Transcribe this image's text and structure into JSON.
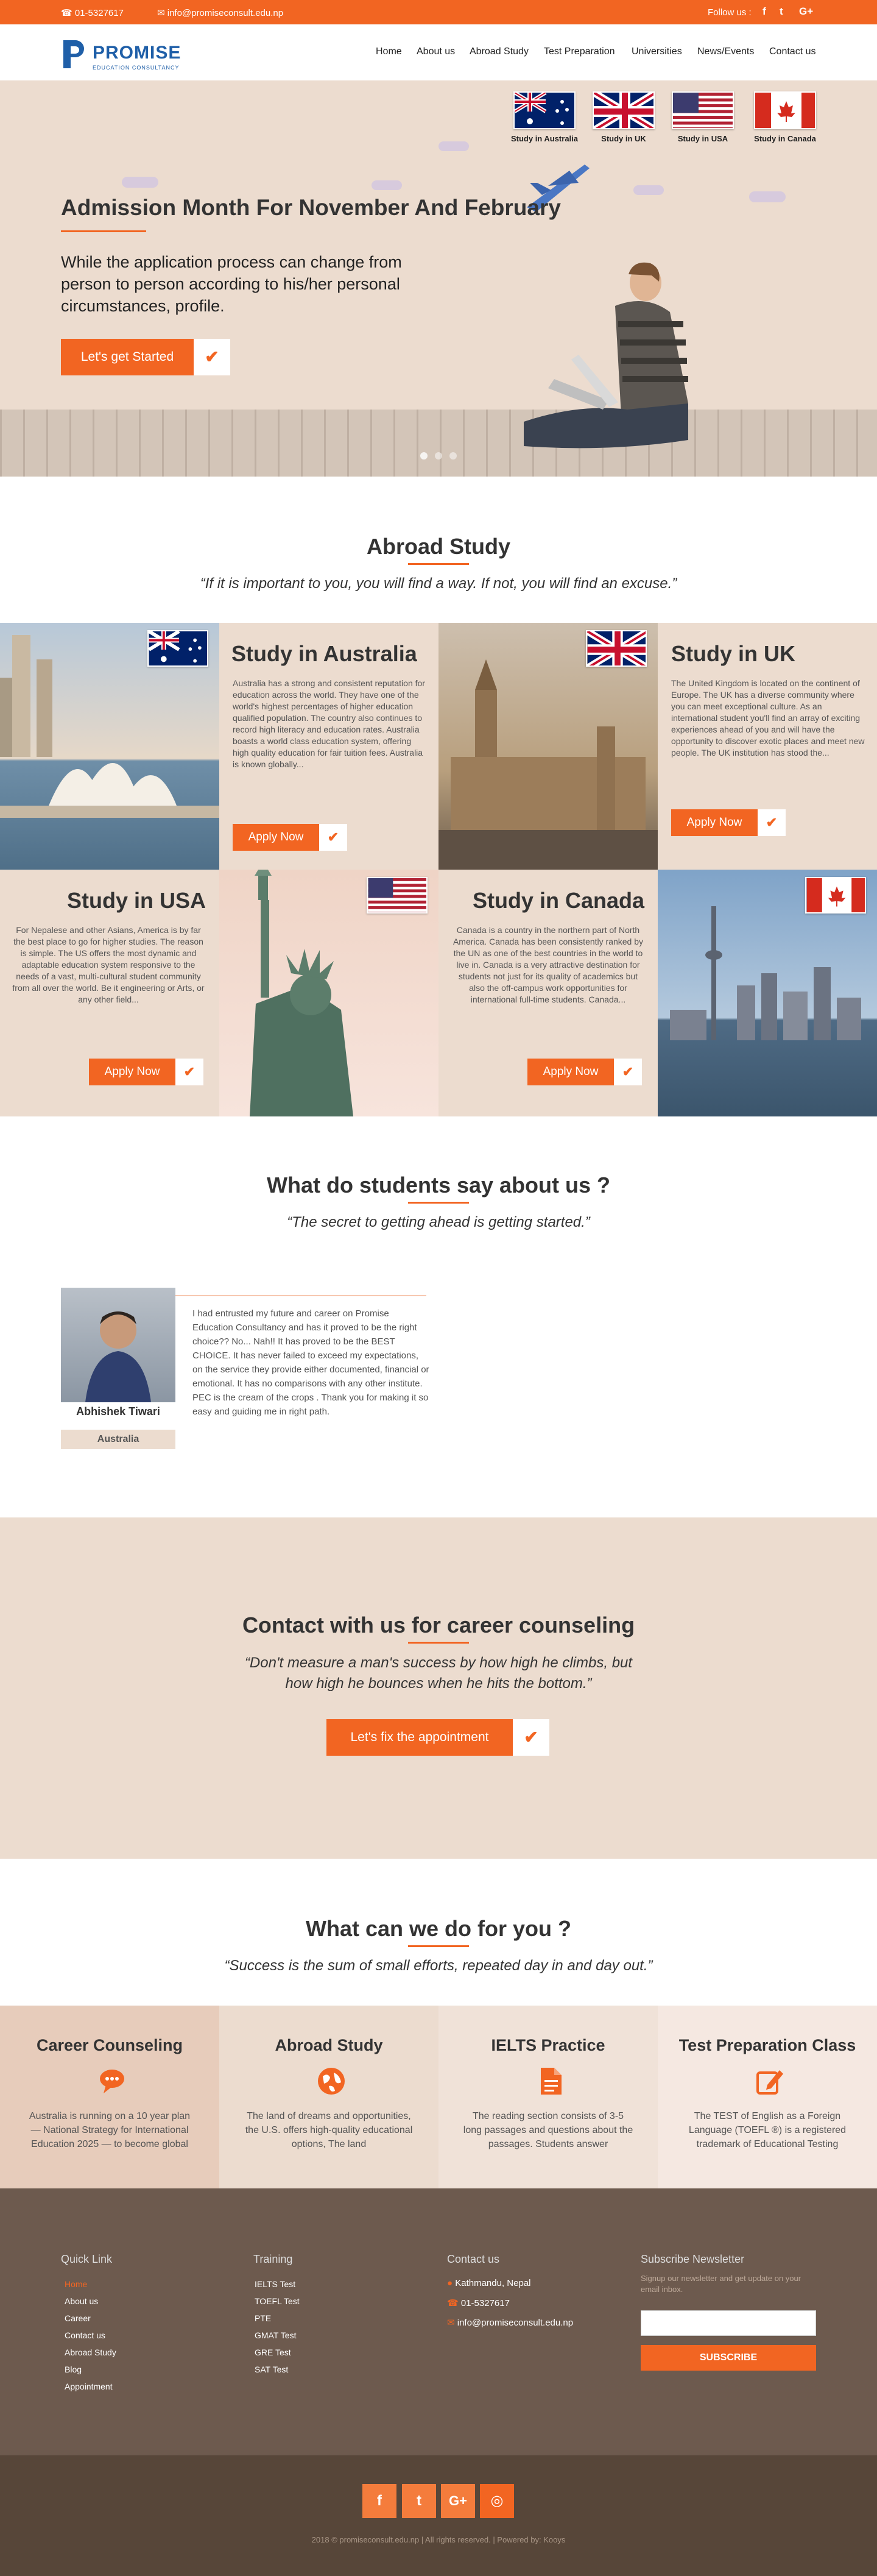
{
  "topbar": {
    "phone": "01-5327617",
    "email": "info@promiseconsult.edu.np",
    "follow": "Follow us :",
    "social": [
      "f",
      "t",
      "G+"
    ]
  },
  "logo": {
    "name": "PROMISE",
    "tagline": "EDUCATION CONSULTANCY"
  },
  "nav": [
    "Home",
    "About us",
    "Abroad Study",
    "Test Preparation",
    "Universities",
    "News/Events",
    "Contact us"
  ],
  "hero": {
    "flags": [
      {
        "label": "Study in Australia",
        "icon": "australia-flag"
      },
      {
        "label": "Study in UK",
        "icon": "uk-flag"
      },
      {
        "label": "Study in USA",
        "icon": "usa-flag"
      },
      {
        "label": "Study in Canada",
        "icon": "canada-flag"
      }
    ],
    "title": "Admission Month For November And February",
    "text": "While the application process can change from person to person according to his/her personal circumstances, profile.",
    "button": "Let's get Started"
  },
  "abroad": {
    "title": "Abroad Study",
    "quote": "“If it is important to you, you will find a way. If not, you will find an excuse.”",
    "countries": [
      {
        "title": "Study in Australia",
        "body": "Australia has a strong and consistent reputation for education across the world. They have one of the world's highest percentages of higher education qualified population. The country also continues to record high literacy and education rates. Australia boasts a world class education system, offering high quality education for fair tuition fees. Australia is known globally...",
        "button": "Apply Now"
      },
      {
        "title": "Study in UK",
        "body": "The United Kingdom is located on the continent of Europe.  The UK has a diverse community where you can meet exceptional culture. As an international student you'll find an array of exciting experiences ahead of you and will have the opportunity to discover exotic places and meet new people. The UK institution has stood the...",
        "button": "Apply Now"
      },
      {
        "title": "Study in USA",
        "body": "For Nepalese and other Asians, America is by far the best place to go for higher studies. The reason is simple. The US offers the most dynamic and adaptable education system responsive to the needs of a vast, multi-cultural student community from all over the world. Be it engineering or Arts, or any other field...",
        "button": "Apply Now"
      },
      {
        "title": "Study in Canada",
        "body": "Canada is a country in the northern part of North America. Canada has been consistently ranked by the UN as one of the best countries in the world to live in.  Canada is a very attractive destination for students not just for its quality of academics but also the off-campus work opportunities for international full-time students. Canada...",
        "button": "Apply Now"
      }
    ]
  },
  "testimonials": {
    "title": "What do students say about us ?",
    "quote": "“The secret to getting ahead is getting started.”",
    "name": "Abhishek Tiwari",
    "country": "Australia",
    "text": "I had entrusted my future and career on Promise Education Consultancy and has it proved to be the right choice?? No... Nah!! It has proved to be the BEST CHOICE. It has never failed to exceed my expectations, on the service they provide either documented, financial or emotional. It has no comparisons with any other institute. PEC is the cream of the crops . Thank you for making it so easy and guiding me in right path."
  },
  "contact": {
    "title": "Contact with us for career counseling",
    "quote": "“Don't measure a man's success by how high he climbs, but how high he bounces when he hits the bottom.”",
    "button": "Let's fix the appointment"
  },
  "services": {
    "title": "What can we do for you ?",
    "quote": "“Success is the sum of small efforts, repeated day in and day out.”",
    "items": [
      {
        "title": "Career Counseling",
        "icon": "chat-icon",
        "body": "Australia is running on a 10 year plan — National Strategy for International Education 2025 — to become global"
      },
      {
        "title": "Abroad Study",
        "icon": "globe-icon",
        "body": "The land of dreams and opportunities, the U.S. offers high-quality educational options, The land"
      },
      {
        "title": "IELTS Practice",
        "icon": "document-icon",
        "body": "The reading section consists of 3-5 long passages and questions about the passages. Students answer"
      },
      {
        "title": "Test Preparation Class",
        "icon": "edit-icon",
        "body": "The TEST of English as a Foreign Language (TOEFL ®) is a registered trademark of Educational Testing"
      }
    ]
  },
  "footer": {
    "quick_title": "Quick Link",
    "quick": [
      "Home",
      "About us",
      "Career",
      "Contact us",
      "Abroad Study",
      "Blog",
      "Appointment"
    ],
    "training_title": "Training",
    "training": [
      "IELTS Test",
      "TOEFL Test",
      "PTE",
      "GMAT Test",
      "GRE Test",
      "SAT Test"
    ],
    "contact_title": "Contact us",
    "address": "Kathmandu, Nepal",
    "phone": "01-5327617",
    "email": "info@promiseconsult.edu.np",
    "news_title": "Subscribe Newsletter",
    "news_text": "Signup our newsletter and get update on your email inbox.",
    "subscribe": "SUBSCRIBE",
    "copyright": "2018 © promiseconsult.edu.np | All rights reserved. | Powered by: Kooys"
  },
  "colors": {
    "accent": "#f26522",
    "beige": "#ecdccf",
    "footer": "#6d5a4e",
    "footer_bottom": "#574639"
  }
}
